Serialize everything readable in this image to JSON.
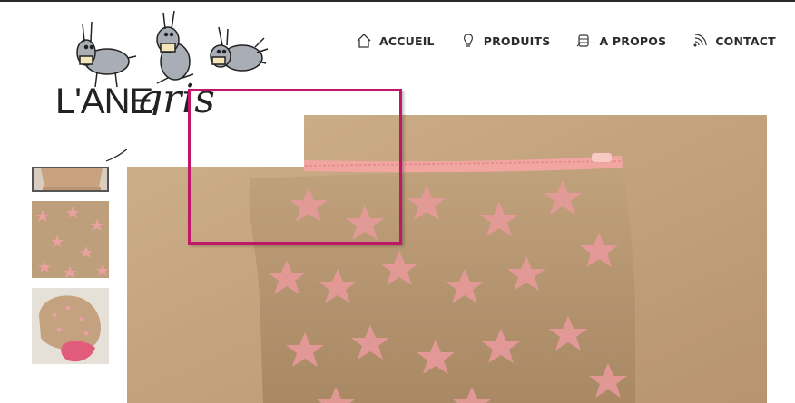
{
  "brand": {
    "name_part1": "L'ANE",
    "name_part2": "gris",
    "logo_icon": "donkey-logo-icon"
  },
  "nav": {
    "items": [
      {
        "label": "ACCUEIL",
        "icon": "home-icon"
      },
      {
        "label": "PRODUITS",
        "icon": "lightbulb-icon"
      },
      {
        "label": "A PROPOS",
        "icon": "thread-spool-icon"
      },
      {
        "label": "CONTACT",
        "icon": "signal-icon"
      }
    ]
  },
  "gallery": {
    "thumbnails": [
      {
        "name": "pouch-bottom-thumbnail",
        "selected": true
      },
      {
        "name": "star-fabric-thumbnail",
        "selected": false
      },
      {
        "name": "pink-lining-thumbnail",
        "selected": false
      }
    ],
    "main_image": "star-print-pouch-photo"
  },
  "colors": {
    "highlight": "#c0176a",
    "fabric": "#b89c73",
    "stars": "#e79a9b",
    "zipper": "#f2a6a2",
    "background_beige": "#c9ab84",
    "text": "#2b2b2b"
  }
}
